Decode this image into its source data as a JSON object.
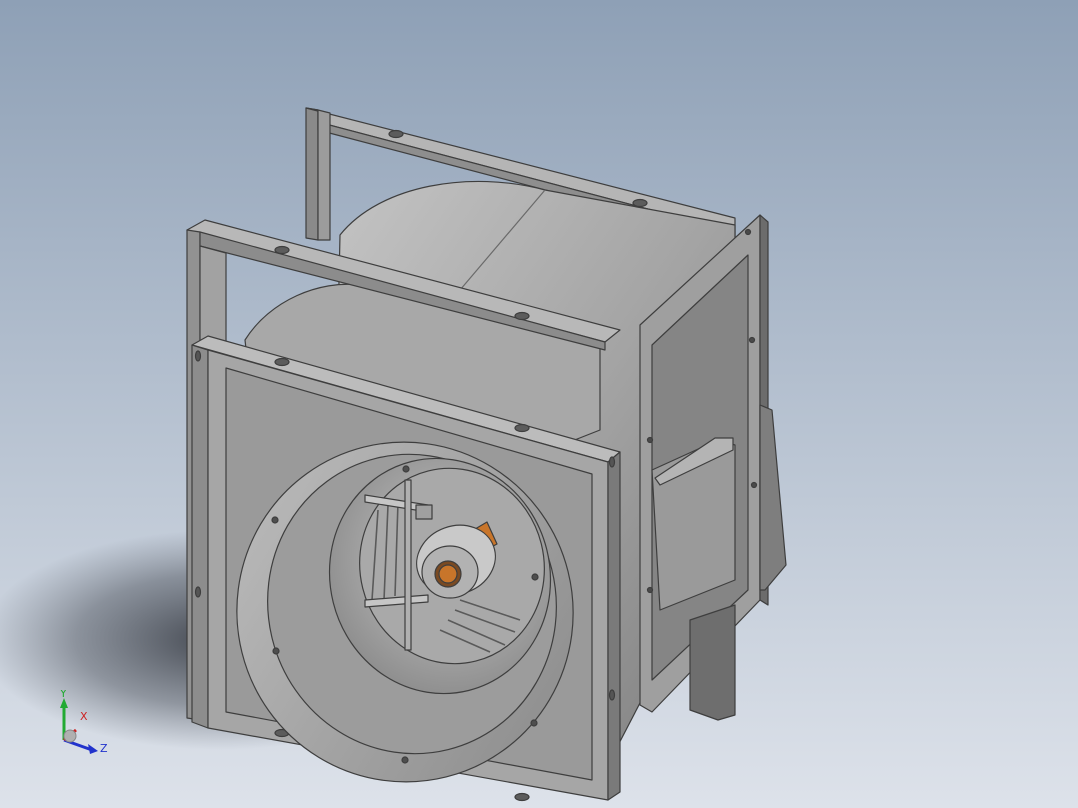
{
  "viewport": {
    "background_top": "#8ea0b6",
    "background_bottom": "#dde2ea"
  },
  "model": {
    "component": "centrifugal-blower-fan",
    "body_color": "#a9a9a9",
    "accent_color": "#c8752a"
  },
  "triad": {
    "x_label": "X",
    "y_label": "Y",
    "z_label": "Z",
    "x_color": "#cc2222",
    "y_color": "#22aa33",
    "z_color": "#2233cc"
  }
}
